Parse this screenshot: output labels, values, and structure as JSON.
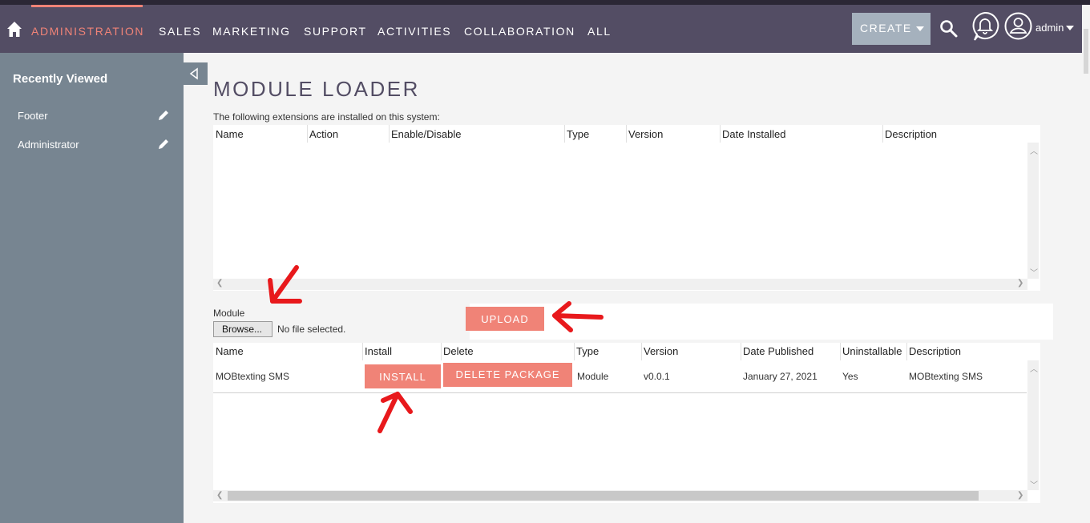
{
  "nav": {
    "items": [
      "ADMINISTRATION",
      "SALES",
      "MARKETING",
      "SUPPORT",
      "ACTIVITIES",
      "COLLABORATION",
      "ALL"
    ],
    "active": "ADMINISTRATION",
    "create_label": "CREATE",
    "user_label": "admin"
  },
  "sidebar": {
    "title": "Recently Viewed",
    "items": [
      {
        "label": "Footer"
      },
      {
        "label": "Administrator"
      }
    ]
  },
  "page": {
    "title": "MODULE LOADER",
    "intro": "The following extensions are installed on this system:"
  },
  "installed_table": {
    "columns": [
      "Name",
      "Action",
      "Enable/Disable",
      "Type",
      "Version",
      "Date Installed",
      "Description"
    ],
    "rows": []
  },
  "upload": {
    "module_label": "Module",
    "browse_label": "Browse...",
    "file_status": "No file selected.",
    "upload_label": "UPLOAD"
  },
  "packages_table": {
    "columns": [
      "Name",
      "Install",
      "Delete",
      "Type",
      "Version",
      "Date Published",
      "Uninstallable",
      "Description"
    ],
    "rows": [
      {
        "name": "MOBtexting SMS",
        "install_label": "INSTALL",
        "delete_label": "DELETE PACKAGE",
        "type": "Module",
        "version": "v0.0.1",
        "date_published": "January 27, 2021",
        "uninstallable": "Yes",
        "description": "MOBtexting SMS"
      }
    ]
  },
  "colors": {
    "topbar": "#534d64",
    "accent": "#f08377",
    "sidebar": "#778591",
    "create_button": "#a5b1bd",
    "annotation_arrow": "#e8191c"
  }
}
